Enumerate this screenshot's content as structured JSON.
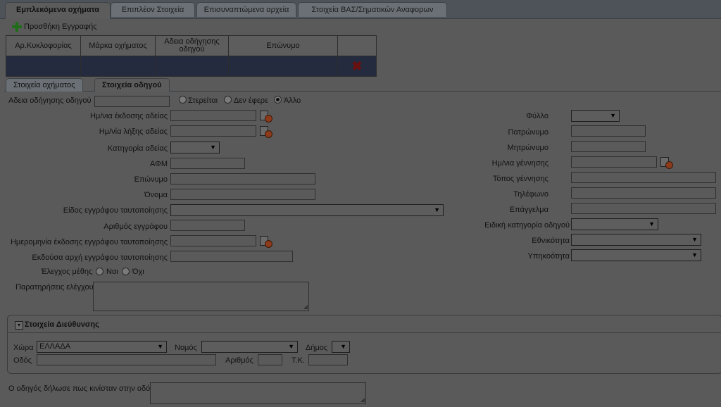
{
  "tabs": [
    "Εμπλεκόμενα οχήματα",
    "Επιπλέον Στοιχεία",
    "Επισυναπτώμενα αρχεία",
    "Στοιχεία ΒΑΣ/Σηματικών Αναφορων"
  ],
  "toolbar": {
    "add_label": "Προσθήκη Εγγραφής"
  },
  "grid": {
    "headers": [
      "Αρ.Κυκλοφορίας",
      "Μάρκα οχήματος",
      "Αδεια οδήγησης οδηγού",
      "Επώνυμο",
      ""
    ],
    "delete_glyph": "✖"
  },
  "subtabs": [
    "Στοιχεία οχήματος",
    "Στοιχεία οδηγού"
  ],
  "license": {
    "label": "Αδεια οδήγησης οδηγού",
    "radio_deprived": "Στερείται",
    "radio_not_carried": "Δεν έφερε",
    "radio_other": "Άλλο"
  },
  "left_fields": {
    "issue_date": "Ημ/νια έκδοσης αδείας",
    "expiry_date": "Ημ/νία λήξης αδείας",
    "category": "Κατηγορία αδείας",
    "afm": "ΑΦΜ",
    "surname": "Επώνυμο",
    "name": "Όνομα",
    "id_type": "Είδος εγγράφου ταυτοποίησης",
    "doc_number": "Αριθμός εγγράφου",
    "doc_issue_date": "Ημερομηνία έκδοσης εγγράφου ταυτοποίησης",
    "doc_authority": "Εκδούσα αρχή εγγράφου ταυτοποίησης",
    "alcohol_check": "Έλεγχος μέθης",
    "yes": "Ναι",
    "no": "Όχι",
    "remarks": "Παρατηρήσεις ελέγχου"
  },
  "right_fields": {
    "gender": "Φύλλο",
    "father_name": "Πατρώνυμο",
    "mother_name": "Μητρώνυμο",
    "birth_date": "Ημ/νια γέννησης",
    "birth_place": "Τόπος γέννησης",
    "phone": "Τηλέφωνο",
    "profession": "Επάγγελμα",
    "special_category": "Ειδική κατηγορία οδηγού",
    "nationality": "Εθνικότητα",
    "citizenship": "Υπηκοότητα"
  },
  "address": {
    "title": "Στοιχεία Διεύθυνσης",
    "country_label": "Χώρα",
    "country_value": "ΕΛΛΑΔΑ",
    "prefecture_label": "Νομός",
    "municipality_label": "Δήμος",
    "street_label": "Οδός",
    "number_label": "Αριθμός",
    "postal_label": "Τ.Κ."
  },
  "footer": {
    "statement_label": "Ο οδηγός δήλωσε πως κινίσταν στην οδό"
  },
  "colors": {
    "overlay_bg": "#5a5a5a",
    "selected_row": "#252b3e",
    "add_icon": "#1f6d18",
    "delete_icon": "#6b0f0f"
  }
}
